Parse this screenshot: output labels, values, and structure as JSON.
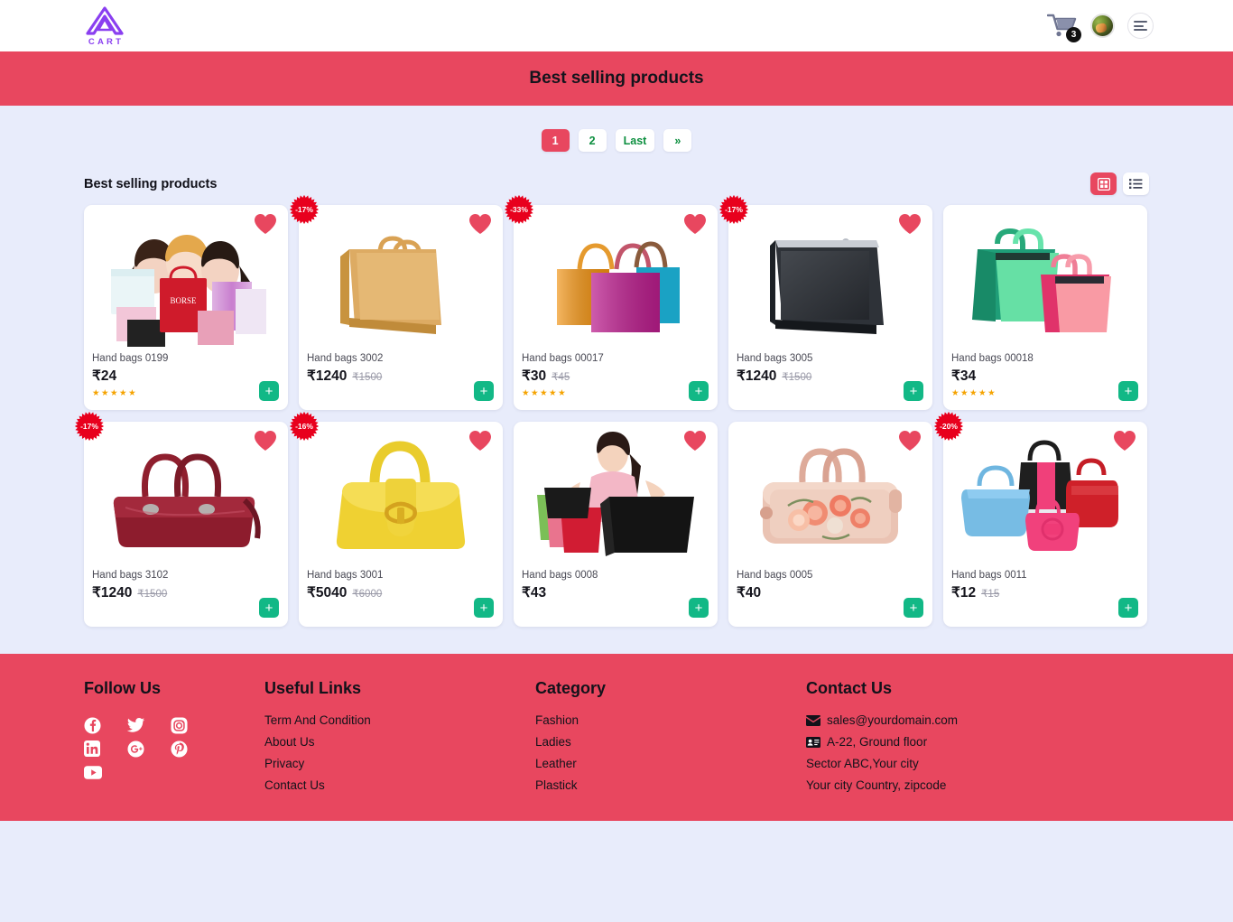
{
  "header": {
    "logo_text": "CART",
    "cart_count": "3",
    "icons": {
      "cart": "shopping-cart-icon",
      "avatar": "user-avatar",
      "menu": "hamburger-menu-icon"
    }
  },
  "banner": {
    "title": "Best selling products"
  },
  "pagination": {
    "items": [
      {
        "label": "1",
        "active": true
      },
      {
        "label": "2",
        "active": false
      },
      {
        "label": "Last",
        "active": false
      },
      {
        "label": "»",
        "active": false
      }
    ]
  },
  "section": {
    "title": "Best selling products",
    "view_grid": "grid-view",
    "view_list": "list-view"
  },
  "products": [
    {
      "name": "Hand bags 0199",
      "price": "₹24",
      "old_price": "",
      "discount": "",
      "stars": "★★★★★",
      "heart": true,
      "add": "+"
    },
    {
      "name": "Hand bags 3002",
      "price": "₹1240",
      "old_price": "₹1500",
      "discount": "-17%",
      "stars": "",
      "heart": true,
      "add": "+"
    },
    {
      "name": "Hand bags 00017",
      "price": "₹30",
      "old_price": "₹45",
      "discount": "-33%",
      "stars": "★★★★★",
      "heart": true,
      "add": "+"
    },
    {
      "name": "Hand bags 3005",
      "price": "₹1240",
      "old_price": "₹1500",
      "discount": "-17%",
      "stars": "",
      "heart": true,
      "add": "+"
    },
    {
      "name": "Hand bags 00018",
      "price": "₹34",
      "old_price": "",
      "discount": "",
      "stars": "★★★★★",
      "heart": false,
      "add": "+"
    },
    {
      "name": "Hand bags 3102",
      "price": "₹1240",
      "old_price": "₹1500",
      "discount": "-17%",
      "stars": "",
      "heart": true,
      "add": "+"
    },
    {
      "name": "Hand bags 3001",
      "price": "₹5040",
      "old_price": "₹6000",
      "discount": "-16%",
      "stars": "",
      "heart": true,
      "add": "+"
    },
    {
      "name": "Hand bags 0008",
      "price": "₹43",
      "old_price": "",
      "discount": "",
      "stars": "",
      "heart": true,
      "add": "+"
    },
    {
      "name": "Hand bags 0005",
      "price": "₹40",
      "old_price": "",
      "discount": "",
      "stars": "",
      "heart": true,
      "add": "+"
    },
    {
      "name": "Hand bags 0011",
      "price": "₹12",
      "old_price": "₹15",
      "discount": "-20%",
      "stars": "",
      "heart": true,
      "add": "+"
    }
  ],
  "footer": {
    "follow": {
      "title": "Follow Us",
      "socials": [
        "facebook-icon",
        "twitter-icon",
        "instagram-icon",
        "linkedin-icon",
        "google-plus-icon",
        "pinterest-icon",
        "youtube-icon"
      ]
    },
    "useful": {
      "title": "Useful Links",
      "links": [
        "Term And Condition",
        "About Us",
        "Privacy",
        "Contact Us"
      ]
    },
    "category": {
      "title": "Category",
      "links": [
        "Fashion",
        "Ladies",
        "Leather",
        "Plastick"
      ]
    },
    "contact": {
      "title": "Contact Us",
      "email": "sales@yourdomain.com",
      "address1": "A-22, Ground floor",
      "address2": "Sector ABC,Your city",
      "address3": "Your city Country, zipcode"
    }
  },
  "colors": {
    "accent_red": "#e8475f",
    "green_add": "#12b886",
    "page_bg": "#e8ecfb",
    "star": "#f5a300"
  }
}
